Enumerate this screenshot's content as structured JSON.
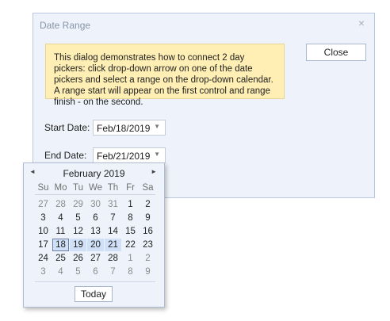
{
  "dialog": {
    "title": "Date Range",
    "close_icon": "×",
    "info_text": "This dialog demonstrates how to connect 2 day pickers: click drop-down arrow on one of the date pickers and select a range on the drop-down calendar. A range start will appear on the first control and range finish - on the second.",
    "close_button": "Close"
  },
  "start": {
    "label": "Start Date:",
    "value": "Feb/18/2019"
  },
  "end": {
    "label": "End Date:",
    "value": "Feb/21/2019"
  },
  "dropdown_arrow": "▼",
  "calendar": {
    "month": "February 2019",
    "prev_icon": "◄",
    "next_icon": "►",
    "weekdays": [
      "Su",
      "Mo",
      "Tu",
      "We",
      "Th",
      "Fr",
      "Sa"
    ],
    "weeks": [
      [
        "27",
        "28",
        "29",
        "30",
        "31",
        "1",
        "2"
      ],
      [
        "3",
        "4",
        "5",
        "6",
        "7",
        "8",
        "9"
      ],
      [
        "10",
        "11",
        "12",
        "13",
        "14",
        "15",
        "16"
      ],
      [
        "17",
        "18",
        "19",
        "20",
        "21",
        "22",
        "23"
      ],
      [
        "24",
        "25",
        "26",
        "27",
        "28",
        "1",
        "2"
      ],
      [
        "3",
        "4",
        "5",
        "6",
        "7",
        "8",
        "9"
      ]
    ],
    "today_label": "Today"
  }
}
